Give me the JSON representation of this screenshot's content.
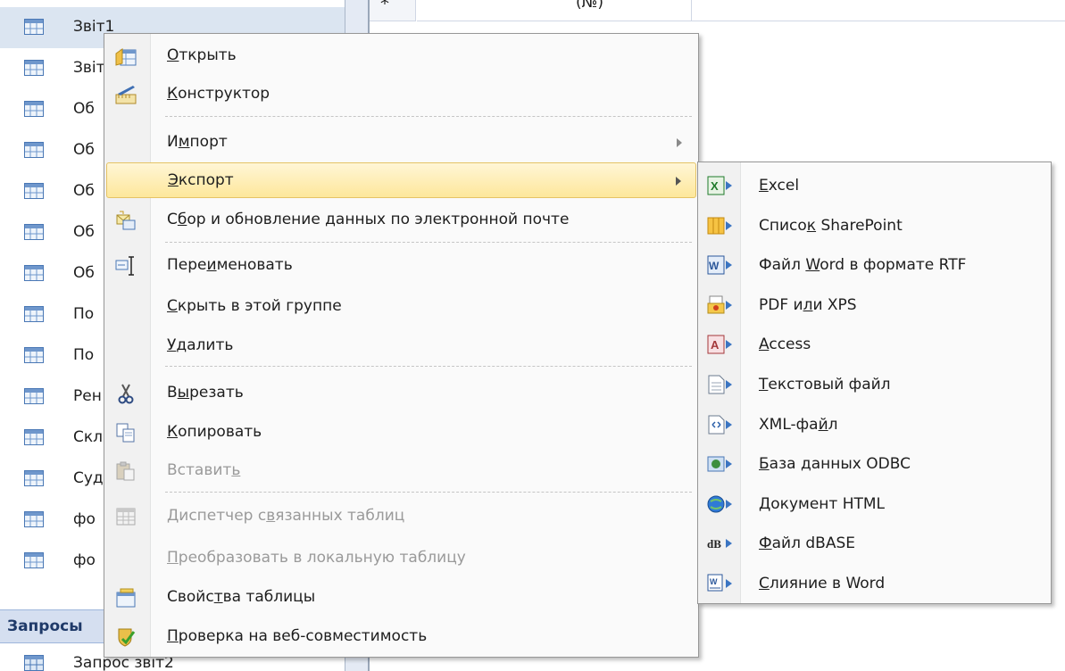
{
  "nav": {
    "items": [
      {
        "label": "Звіт1",
        "selected": true
      },
      {
        "label": "Звіт"
      },
      {
        "label": "Об"
      },
      {
        "label": "Об"
      },
      {
        "label": "Об"
      },
      {
        "label": "Об"
      },
      {
        "label": "Об"
      },
      {
        "label": "По"
      },
      {
        "label": "По"
      },
      {
        "label": "Рен"
      },
      {
        "label": "Скл"
      },
      {
        "label": "Суд"
      },
      {
        "label": "фо"
      },
      {
        "label": "фо"
      }
    ],
    "group_label": "Запросы",
    "query_item": "Запрос звіт2"
  },
  "sheet": {
    "row_marker": "*",
    "header_text": "(№)"
  },
  "menu": {
    "items": [
      {
        "label": "Открыть",
        "icon": "open-table-icon",
        "u": "О"
      },
      {
        "label": "Конструктор",
        "icon": "design-view-icon",
        "u": "К"
      },
      {
        "label": "Импорт",
        "submenu": true,
        "u": "м"
      },
      {
        "label": "Экспорт",
        "submenu": true,
        "highlight": true,
        "u": "Э"
      },
      {
        "label": "Сбор и обновление данных по электронной почте",
        "icon": "email-collect-icon",
        "u": "б"
      },
      {
        "label": "Переименовать",
        "icon": "rename-icon",
        "u": "и"
      },
      {
        "label": "Скрыть в этой группе",
        "u": "С"
      },
      {
        "label": "Удалить",
        "u": "У"
      },
      {
        "label": "Вырезать",
        "icon": "scissors-icon",
        "u": "ы"
      },
      {
        "label": "Копировать",
        "icon": "copy-icon",
        "u": "К"
      },
      {
        "label": "Вставить",
        "icon": "paste-icon",
        "disabled": true,
        "u": "ь"
      },
      {
        "label": "Диспетчер связанных таблиц",
        "icon": "linked-table-manager-icon",
        "disabled": true,
        "u": "в"
      },
      {
        "label": "Преобразовать в локальную таблицу",
        "disabled": true,
        "u": "П"
      },
      {
        "label": "Свойства таблицы",
        "icon": "table-properties-icon",
        "u": "т"
      },
      {
        "label": "Проверка на веб-совместимость",
        "icon": "web-check-icon",
        "u": "П"
      }
    ]
  },
  "submenu": {
    "items": [
      {
        "label": "Excel",
        "icon": "excel-icon",
        "u": "E"
      },
      {
        "label": "Список SharePoint",
        "icon": "sharepoint-list-icon",
        "u": "к"
      },
      {
        "label": "Файл Word в формате RTF",
        "icon": "word-rtf-icon",
        "u": "W"
      },
      {
        "label": "PDF или XPS",
        "icon": "pdf-xps-icon",
        "u": "л"
      },
      {
        "label": "Access",
        "icon": "access-icon",
        "u": "A"
      },
      {
        "label": "Текстовый файл",
        "icon": "text-file-icon",
        "u": "Т"
      },
      {
        "label": "XML-файл",
        "icon": "xml-file-icon",
        "u": "й"
      },
      {
        "label": "База данных ODBC",
        "icon": "odbc-database-icon",
        "u": "Б"
      },
      {
        "label": "Документ HTML",
        "icon": "html-document-icon",
        "u": "Д"
      },
      {
        "label": "Файл dBASE",
        "icon": "dbase-icon",
        "u": "Ф"
      },
      {
        "label": "Слияние в Word",
        "icon": "word-merge-icon",
        "u": "С"
      }
    ]
  },
  "colors": {
    "selection": "#dbe5f1",
    "highlight_top": "#fff6d6",
    "highlight_bottom": "#fde79b",
    "group_header": "#d5dff0"
  }
}
